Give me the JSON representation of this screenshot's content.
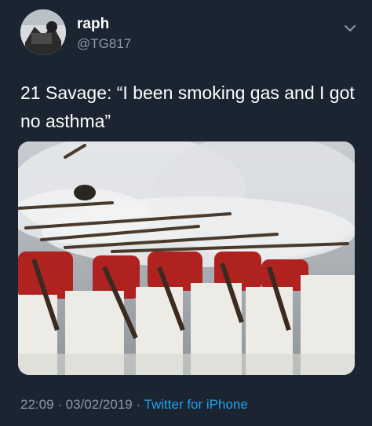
{
  "tweet": {
    "author_name": "raph",
    "author_handle": "@TG817",
    "text": "21 Savage: “I been smoking gas and I got no asthma”",
    "timestamp": "22:09 · 03/02/2019 · ",
    "source": "Twitter for iPhone"
  },
  "icons": {
    "menu": "chevron-down-icon"
  },
  "colors": {
    "background": "#1b2532",
    "secondary_text": "#8899a6",
    "link": "#1da1f2"
  }
}
